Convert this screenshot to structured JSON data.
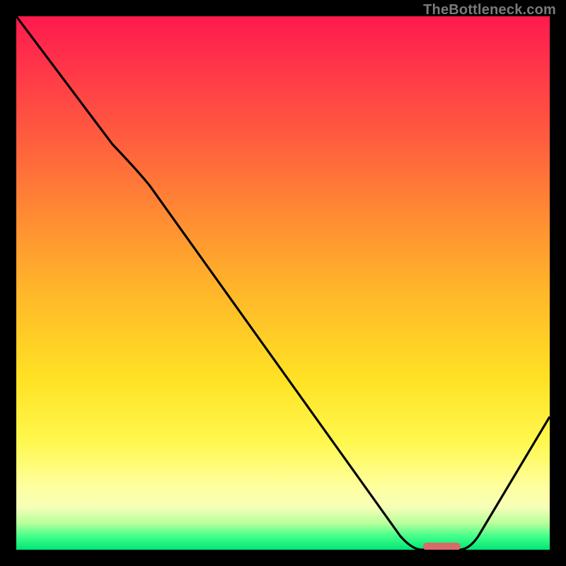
{
  "watermark": "TheBottleneck.com",
  "chart_data": {
    "type": "line",
    "title": "",
    "xlabel": "",
    "ylabel": "",
    "xlim": [
      0,
      100
    ],
    "ylim": [
      0,
      100
    ],
    "grid": false,
    "legend": false,
    "gradient_stops": [
      {
        "pos": 0,
        "color": "#ff1a4d"
      },
      {
        "pos": 0.22,
        "color": "#ff5a3f"
      },
      {
        "pos": 0.51,
        "color": "#ffb52a"
      },
      {
        "pos": 0.8,
        "color": "#fff84f"
      },
      {
        "pos": 0.95,
        "color": "#b8ff9b"
      },
      {
        "pos": 1.0,
        "color": "#00e676"
      }
    ],
    "series": [
      {
        "name": "bottleneck-curve",
        "x": [
          0,
          18,
          25,
          72,
          76,
          83,
          100
        ],
        "values": [
          100,
          76,
          70,
          2,
          0,
          0,
          25
        ]
      }
    ],
    "marker": {
      "name": "optimal-range",
      "x_start": 76,
      "x_end": 83,
      "y": 0,
      "color": "#d86a6a"
    }
  }
}
